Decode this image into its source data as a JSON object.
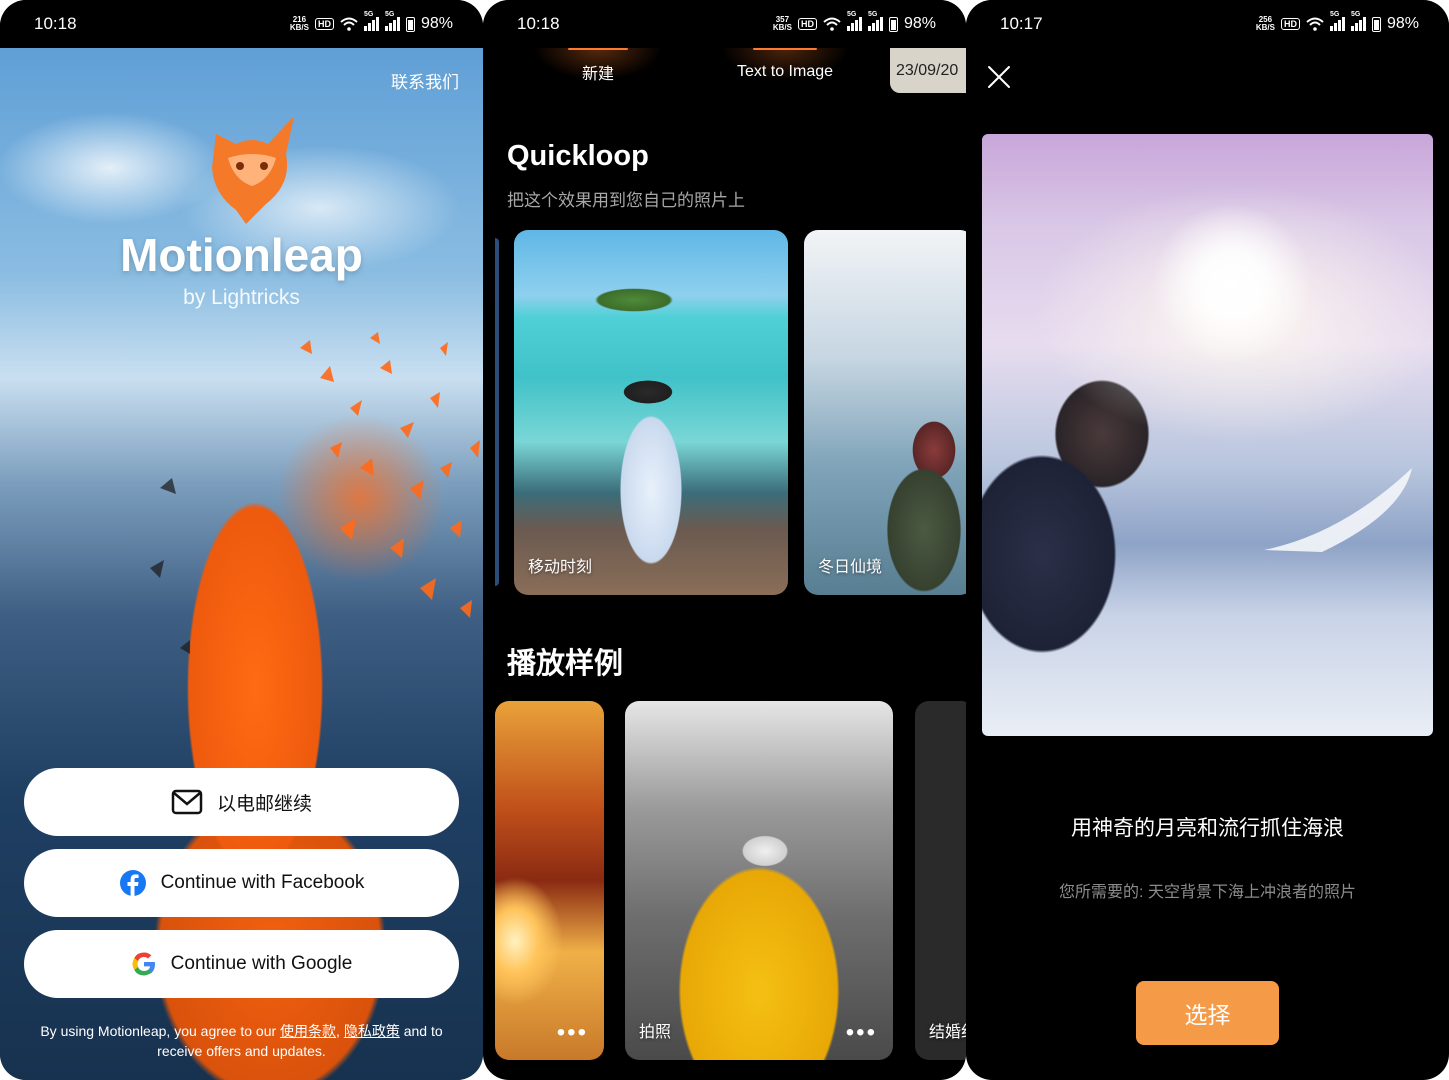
{
  "screens": [
    {
      "status": {
        "time": "10:18",
        "speed_top": "216",
        "speed_unit": "KB/S",
        "hd": "HD",
        "net1": "5G",
        "net2": "5G",
        "battery": "98%"
      },
      "contact_label": "联系我们",
      "brand": {
        "name": "Motionleap",
        "byline": "by Lightricks"
      },
      "buttons": {
        "email": "以电邮继续",
        "facebook": "Continue with Facebook",
        "google": "Continue with Google"
      },
      "terms": {
        "prefix": "By using Motionleap, you agree to our ",
        "terms_link": "使用条款",
        "separator": ", ",
        "privacy_link": "隐私政策",
        "suffix": " and to receive offers and updates."
      },
      "colors": {
        "accent": "#f36a1a",
        "facebook": "#1877f2"
      }
    },
    {
      "status": {
        "time": "10:18",
        "speed_top": "357",
        "speed_unit": "KB/S",
        "hd": "HD",
        "net1": "5G",
        "net2": "5G",
        "battery": "98%"
      },
      "tabs": {
        "new": "新建",
        "text_to_image": "Text to Image",
        "date": "23/09/20"
      },
      "quickloop": {
        "title": "Quickloop",
        "subtitle": "把这个效果用到您自己的照片上",
        "cards": [
          "移动时刻",
          "冬日仙境"
        ]
      },
      "samples": {
        "title": "播放样例",
        "cards": [
          "",
          "拍照",
          "结婚纪"
        ],
        "more": "•••"
      }
    },
    {
      "status": {
        "time": "10:17",
        "speed_top": "256",
        "speed_unit": "KB/S",
        "hd": "HD",
        "net1": "5G",
        "net2": "5G",
        "battery": "98%"
      },
      "headline": "用神奇的月亮和流行抓住海浪",
      "description": "您所需要的: 天空背景下海上冲浪者的照片",
      "select_label": "选择",
      "colors": {
        "select_button": "#f59a46"
      }
    }
  ]
}
